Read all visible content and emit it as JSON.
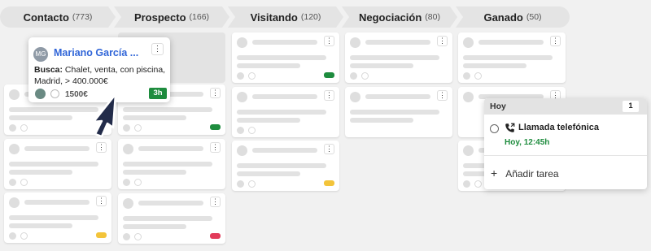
{
  "pipeline": {
    "stages": [
      {
        "name": "Contacto",
        "count": "(773)"
      },
      {
        "name": "Prospecto",
        "count": "(166)"
      },
      {
        "name": "Visitando",
        "count": "(120)"
      },
      {
        "name": "Negociación",
        "count": "(80)"
      },
      {
        "name": "Ganado",
        "count": "(50)"
      }
    ]
  },
  "popup_card": {
    "initials": "MG",
    "name": "Mariano García ...",
    "search_label": "Busca:",
    "search_text": " Chalet, venta, con piscina, Madrid, > 400.000€",
    "amount": "1500€",
    "time_badge": "3h",
    "kebab": "⋮"
  },
  "task_panel": {
    "title": "Hoy",
    "count": "1",
    "task_name": "Llamada telefónica",
    "task_time": "Hoy, 12:45h",
    "add_label": "Añadir tarea",
    "add_icon": "+"
  },
  "colors": {
    "tag_green": "#1e8c3e",
    "tag_yellow": "#f3c43a",
    "tag_red": "#e23b5a"
  }
}
